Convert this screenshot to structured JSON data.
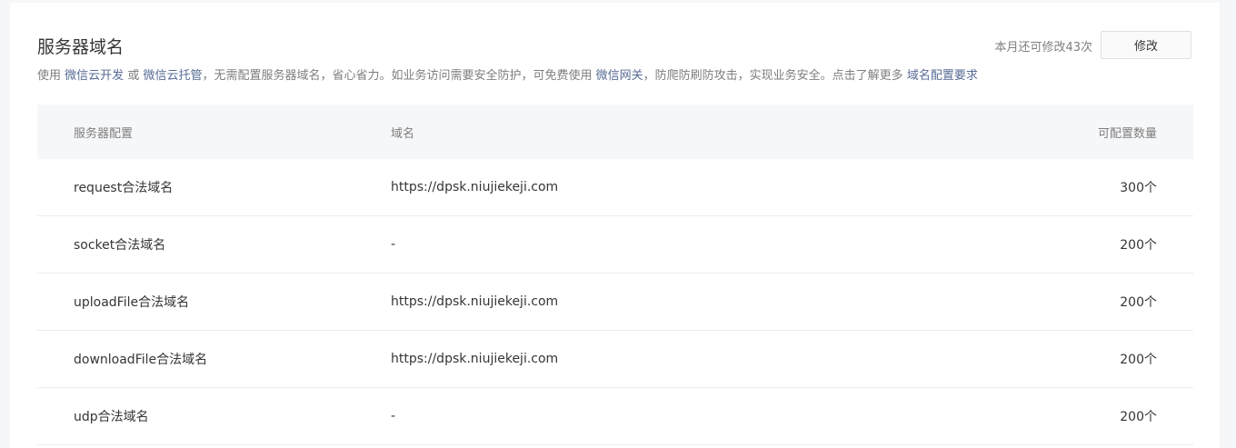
{
  "header": {
    "title": "服务器域名",
    "quota_text": "本月还可修改43次",
    "modify_label": "修改"
  },
  "desc": {
    "t1": "使用",
    "link1": "微信云开发",
    "t2": "或",
    "link2": "微信云托管",
    "t3": "，无需配置服务器域名，省心省力。如业务访问需要安全防护，可免费使用",
    "link3": "微信网关",
    "t4": "，防爬防刷防攻击，实现业务安全。点击了解更多",
    "link4": "域名配置要求"
  },
  "table": {
    "headers": [
      "服务器配置",
      "域名",
      "可配置数量"
    ],
    "rows": [
      {
        "config": "request合法域名",
        "domain": "https://dpsk.niujiekeji.com",
        "count": "300个"
      },
      {
        "config": "socket合法域名",
        "domain": "-",
        "count": "200个"
      },
      {
        "config": "uploadFile合法域名",
        "domain": "https://dpsk.niujiekeji.com",
        "count": "200个"
      },
      {
        "config": "downloadFile合法域名",
        "domain": "https://dpsk.niujiekeji.com",
        "count": "200个"
      },
      {
        "config": "udp合法域名",
        "domain": "-",
        "count": "200个"
      }
    ]
  }
}
